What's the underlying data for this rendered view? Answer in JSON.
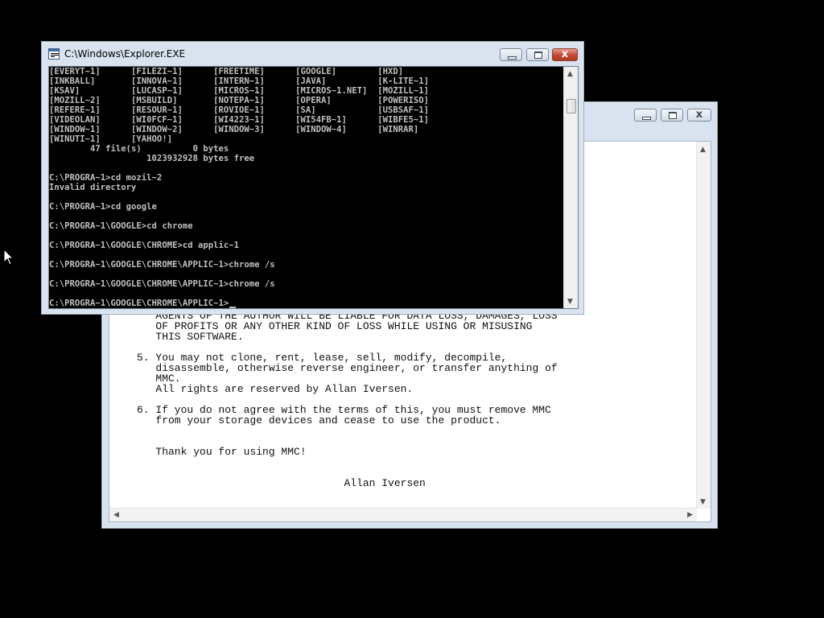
{
  "console_window": {
    "title": "C:\\Windows\\Explorer.EXE",
    "close_glyph": "x",
    "lines": [
      "[EVERYT~1]      [FILEZI~1]      [FREETIME]      [GOOGLE]        [HXD]",
      "[INKBALL]       [INNOVA~1]      [INTERN~1]      [JAVA]          [K-LITE~1]",
      "[KSAV]          [LUCASP~1]      [MICROS~1]      [MICROS~1.NET]  [MOZILL~1]",
      "[MOZILL~2]      [MSBUILD]       [NOTEPA~1]      [OPERA]         [POWERISO]",
      "[REFERE~1]      [RESOUR~1]      [ROVIOE~1]      [SA]            [USBSAF~1]",
      "[VIDEOLAN]      [WI0FCF~1]      [WI4223~1]      [WI54FB~1]      [WIBFE5~1]",
      "[WINDOW~1]      [WINDOW~2]      [WINDOW~3]      [WINDOW~4]      [WINRAR]",
      "[WINUTI~1]      [YAHOO!]",
      "        47 file(s)          0 bytes",
      "                   1023932928 bytes free",
      "",
      "C:\\PROGRA~1>cd mozil~2",
      "Invalid directory",
      "",
      "C:\\PROGRA~1>cd google",
      "",
      "C:\\PROGRA~1\\GOOGLE>cd chrome",
      "",
      "C:\\PROGRA~1\\GOOGLE\\CHROME>cd applic~1",
      "",
      "C:\\PROGRA~1\\GOOGLE\\CHROME\\APPLIC~1>chrome /s",
      "",
      "C:\\PROGRA~1\\GOOGLE\\CHROME\\APPLIC~1>chrome /s",
      "",
      "C:\\PROGRA~1\\GOOGLE\\CHROME\\APPLIC~1>"
    ]
  },
  "readme_window": {
    "title": "",
    "close_glyph": "x",
    "lines": [
      "   AGENTS OF THE AUTHOR WILL BE LIABLE FOR DATA LOSS, DAMAGES, LOSS",
      "   OF PROFITS OR ANY OTHER KIND OF LOSS WHILE USING OR MISUSING",
      "   THIS SOFTWARE.",
      "",
      "5. You may not clone, rent, lease, sell, modify, decompile,",
      "   disassemble, otherwise reverse engineer, or transfer anything of",
      "   MMC.",
      "   All rights are reserved by Allan Iversen.",
      "",
      "6. If you do not agree with the terms of this, you must remove MMC",
      "   from your storage devices and cease to use the product.",
      "",
      "",
      "   Thank you for using MMC!",
      "",
      "",
      "                                 Allan Iversen"
    ]
  },
  "icons": {
    "console_icon": "command-prompt-icon",
    "pointer": "mouse-pointer-icon"
  },
  "colors": {
    "desktop": "#000000",
    "console_text": "#c0c0c0",
    "close_button": "#c24a34"
  }
}
